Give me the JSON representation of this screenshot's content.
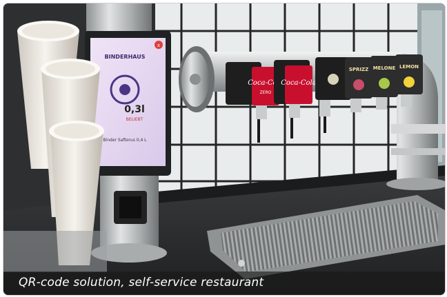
{
  "caption": "QR-code solution, self-service restaurant",
  "screen": {
    "brand": "BINDERHAUS",
    "size": "0,3l",
    "sub": "BELIEBT",
    "bottom": "Binder Saftorus 0,4 L",
    "close": "x"
  },
  "taps": [
    {
      "label": "Coca-Cola",
      "sub": "ZERO",
      "color": "#c8102e"
    },
    {
      "label": "Coca-Cola",
      "sub": "",
      "color": "#c8102e"
    },
    {
      "label": "",
      "sub": "",
      "color": "#2a2a2a"
    },
    {
      "label": "SPRIZZ",
      "sub": "",
      "color": "#3a3a3a"
    },
    {
      "label": "MELONE",
      "sub": "",
      "color": "#3a3a3a"
    },
    {
      "label": "LEMON",
      "sub": "",
      "color": "#3a3a3a"
    }
  ],
  "colors": {
    "tile": "#e9ecec",
    "grout": "#262626",
    "counter": "#2b2d2f",
    "steel": "#b9bcbd",
    "screen": "#e8d6f0"
  }
}
